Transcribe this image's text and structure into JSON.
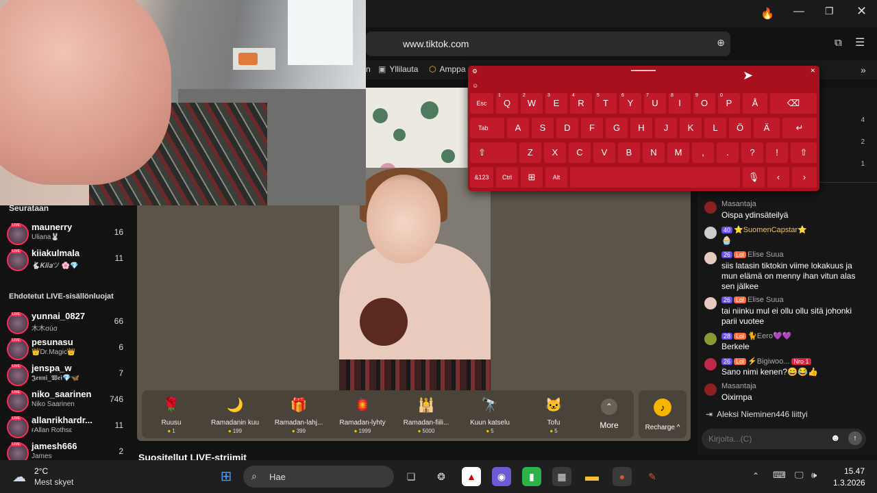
{
  "browser": {
    "url": "www.tiktok.com",
    "bookmarks": [
      "Yllilauta",
      "Amppa"
    ]
  },
  "sidebar": {
    "following_title": "Seurataan",
    "following": [
      {
        "name": "maunerry",
        "sub": "Uliana🐰",
        "count": "16"
      },
      {
        "name": "kiiakulmala",
        "sub": "🐇𝑲𝒊𝒊𝒂ツ 🌸💎",
        "count": "11"
      }
    ],
    "suggested_title": "Ehdotetut LIVE-sisällönluojat",
    "suggested": [
      {
        "name": "yunnai_0827",
        "sub": "木木σúσ",
        "count": "66"
      },
      {
        "name": "pesunasu",
        "sub": "👑Dr.Magic👑",
        "count": "6"
      },
      {
        "name": "jenspa_w",
        "sub": "𝕵𝖊𝖓𝖓𝖎_𝖂𝖊𝖎💎🦋",
        "count": "7"
      },
      {
        "name": "niko_saarinen",
        "sub": "Niko Saarinen",
        "count": "746"
      },
      {
        "name": "allanrikhardr...",
        "sub": "ғAllan Rothsε",
        "count": "11"
      },
      {
        "name": "jamesh666",
        "sub": "James",
        "count": "2"
      }
    ]
  },
  "gifts": [
    {
      "name": "Ruusu",
      "price": "1",
      "icon": "🌹"
    },
    {
      "name": "Ramadanin kuu",
      "price": "199",
      "icon": "🌙"
    },
    {
      "name": "Ramadan-lahj...",
      "price": "399",
      "icon": "🎁"
    },
    {
      "name": "Ramadan-lyhty",
      "price": "1999",
      "icon": "🏮"
    },
    {
      "name": "Ramadan-fiili...",
      "price": "5000",
      "icon": "🕌"
    },
    {
      "name": "Kuun katselu",
      "price": "5",
      "icon": "🔭"
    },
    {
      "name": "Tofu",
      "price": "5",
      "icon": "🐱"
    }
  ],
  "more_label": "More",
  "recharge_label": "Recharge ^",
  "recommended_title": "Suositellut LIVE-striimit",
  "chat": {
    "stats": [
      "4",
      "2",
      "1"
    ],
    "messages": [
      {
        "name": "Masantaja",
        "badges": [],
        "text": "Oispa ydinsäteilyä"
      },
      {
        "name": "⭐SuomenCapstar⭐",
        "badges": [
          "40"
        ],
        "text": "🧁"
      },
      {
        "name": "Elise Suua",
        "badges": [
          "26",
          "Lol"
        ],
        "text": "siis latasin tiktokin viime lokakuus ja mun elämä on menny ihan vitun alas sen jälkee"
      },
      {
        "name": "Elise Suua",
        "badges": [
          "26",
          "Lol"
        ],
        "text": "tai niinku mul ei ollu ollu sitä johonki parii vuotee"
      },
      {
        "name": "🐈Eero💜💜",
        "badges": [
          "28",
          "Lol"
        ],
        "text": "Berkele"
      },
      {
        "name": "⚡Bigiwoo...",
        "badges": [
          "26",
          "Lol",
          "Nro 1"
        ],
        "text": "Sano nimi kenen?😄😂👍"
      },
      {
        "name": "Masantaja",
        "badges": [],
        "text": "Oixirnpa"
      }
    ],
    "joined": "Aleksi Nieminen446  liittyi",
    "input_placeholder": "Kirjoita...(C)"
  },
  "keyboard": {
    "row1": [
      "Esc",
      "Q",
      "W",
      "E",
      "R",
      "T",
      "Y",
      "U",
      "I",
      "O",
      "P",
      "Å",
      "⌫"
    ],
    "row1_sup": [
      "",
      "1",
      "2",
      "3",
      "4",
      "5",
      "6",
      "7",
      "8",
      "9",
      "0",
      "",
      ""
    ],
    "row2": [
      "Tab",
      "A",
      "S",
      "D",
      "F",
      "G",
      "H",
      "J",
      "K",
      "L",
      "Ö",
      "Ä",
      "↵"
    ],
    "row3": [
      "⇧",
      "Z",
      "X",
      "C",
      "V",
      "B",
      "N",
      "M",
      ",",
      ".",
      "?",
      "!",
      "⇧"
    ],
    "row4": [
      "&123",
      "Ctrl",
      "⊞",
      "Alt",
      "",
      "🎙",
      "‹",
      "›"
    ]
  },
  "taskbar": {
    "weather_temp": "2°C",
    "weather_desc": "Mest skyet",
    "search_placeholder": "Hae",
    "time": "15.47",
    "date": "1.3.2026"
  }
}
